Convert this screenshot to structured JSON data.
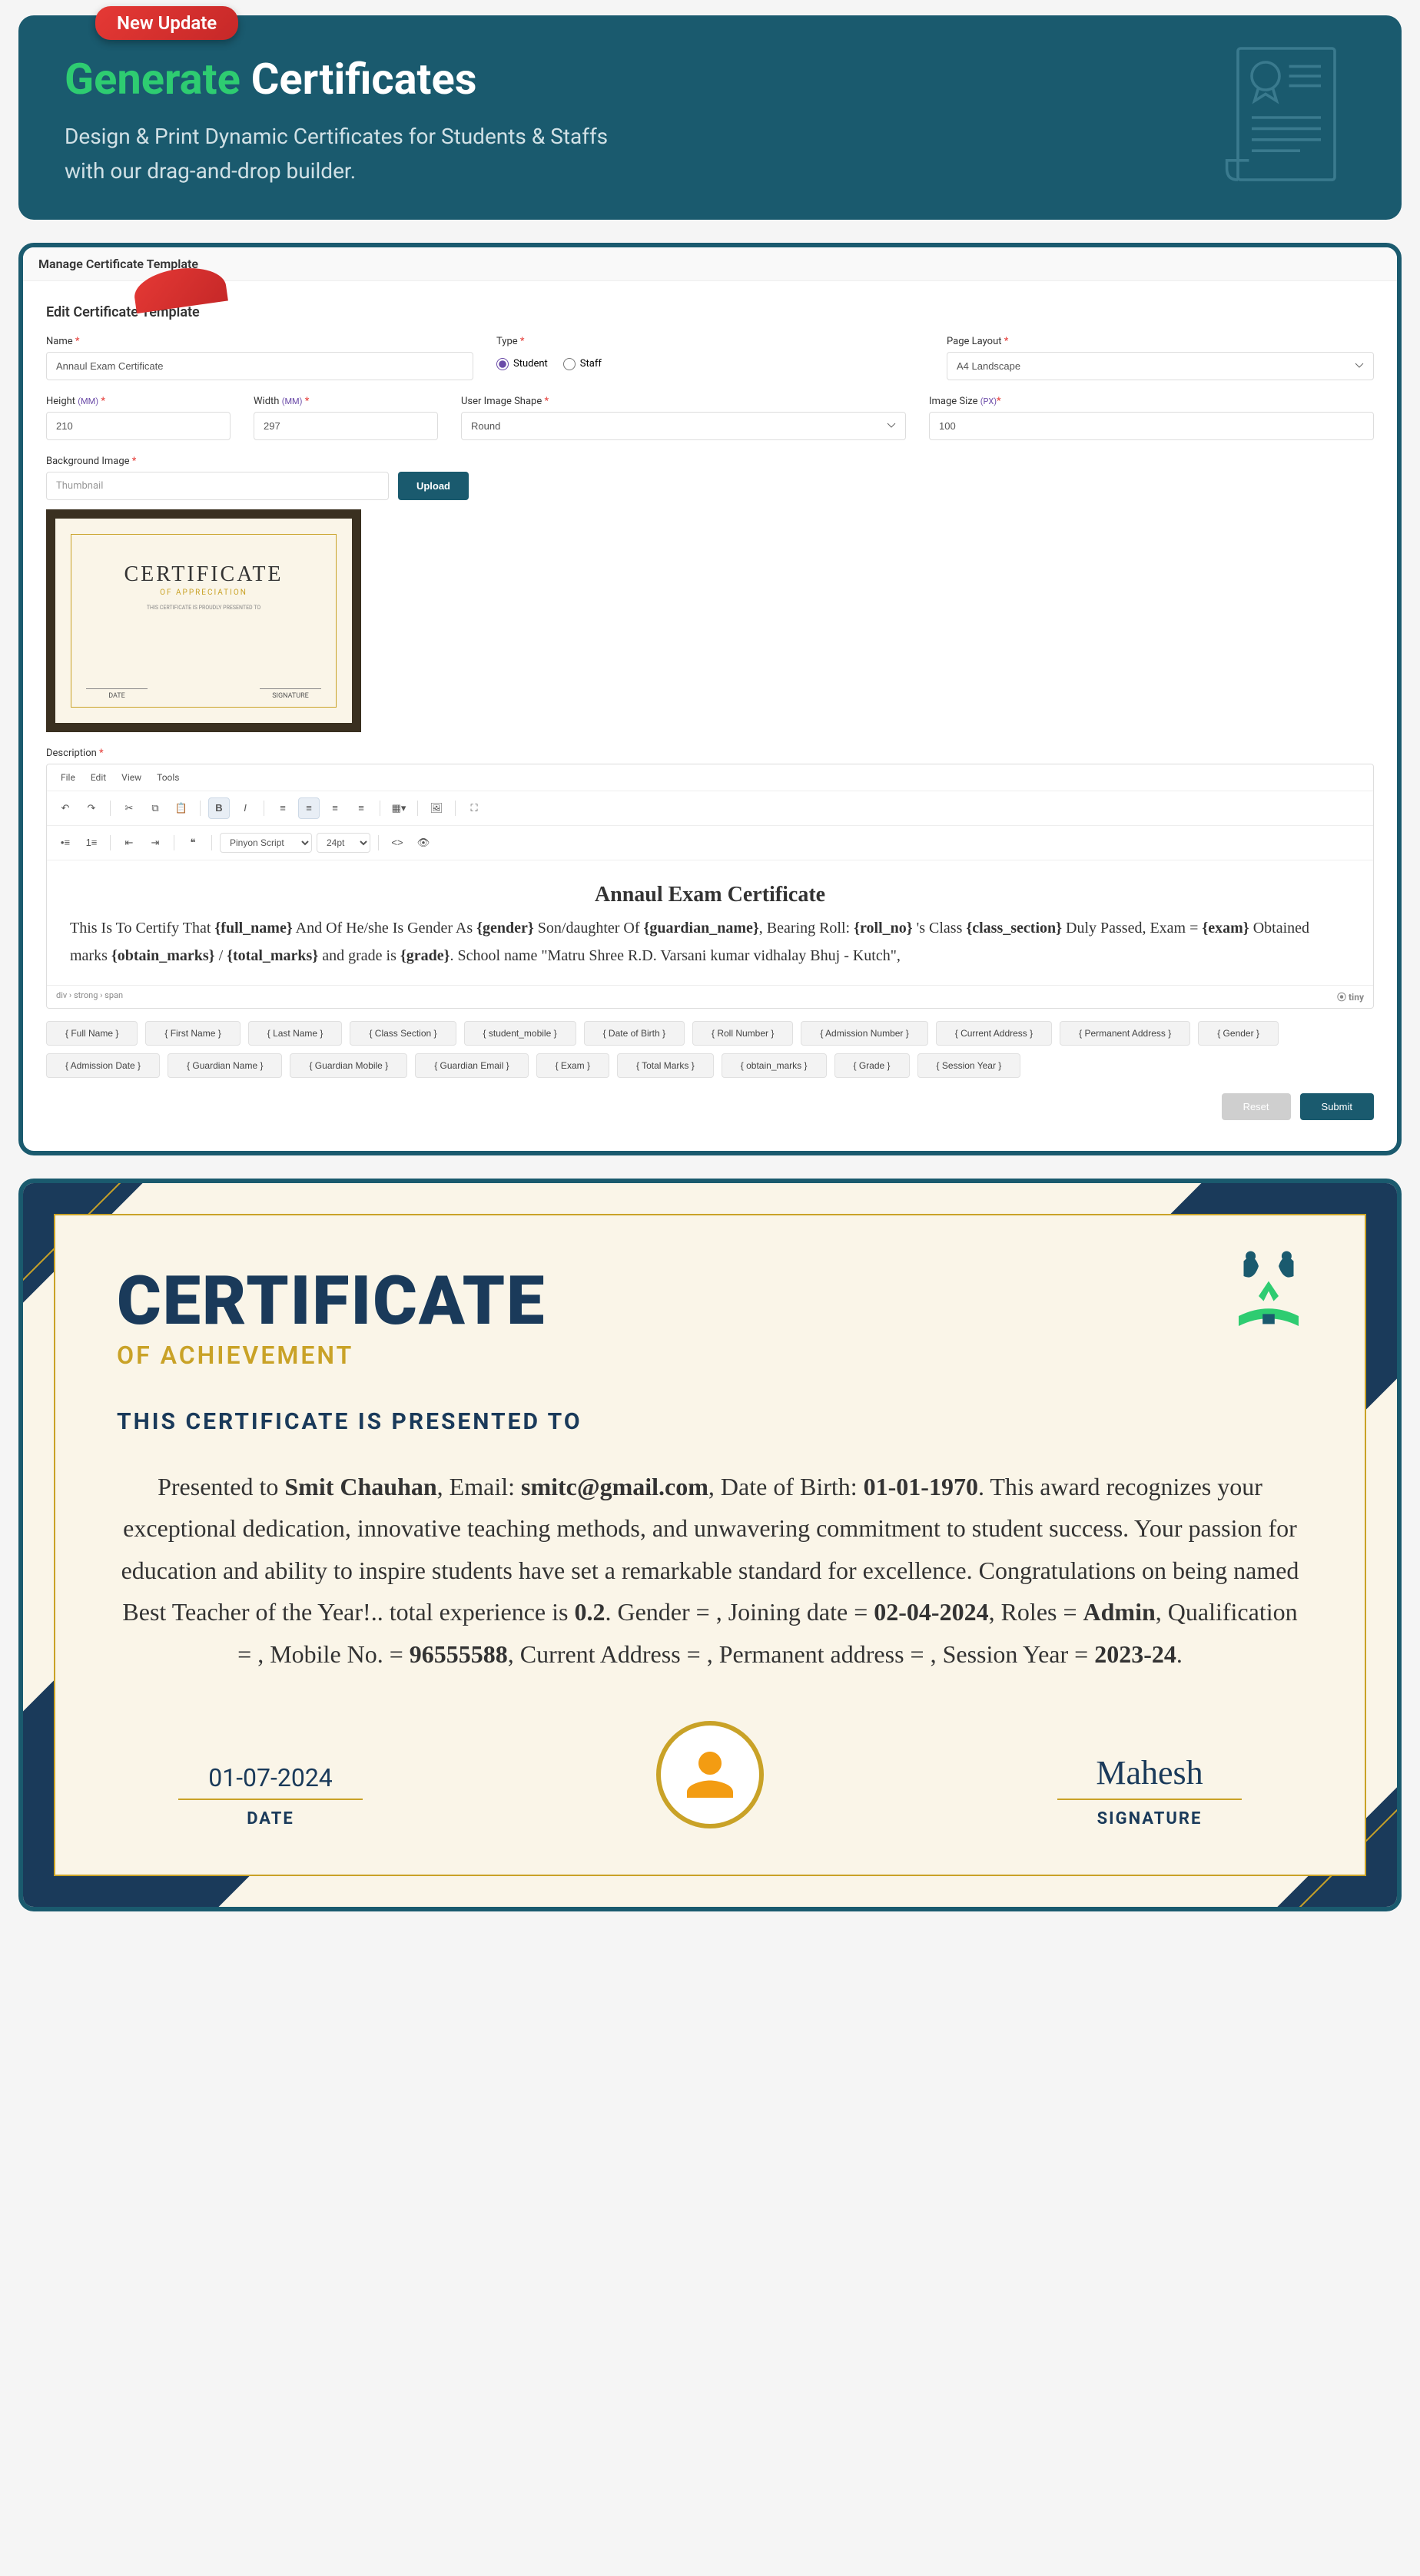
{
  "banner": {
    "badge": "New Update",
    "title_green": "Generate",
    "title_rest": "Certificates",
    "line1": "Design & Print Dynamic Certificates for Students & Staffs",
    "line2": "with our drag-and-drop builder."
  },
  "panel": {
    "header": "Manage Certificate Template",
    "form_title": "Edit Certificate Template",
    "labels": {
      "name": "Name",
      "type": "Type",
      "page_layout": "Page Layout",
      "height": "Height",
      "width": "Width",
      "user_image_shape": "User Image Shape",
      "image_size": "Image Size",
      "background_image": "Background Image",
      "description": "Description",
      "mm_unit": "(MM)",
      "px_unit": "(PX)"
    },
    "values": {
      "name": "Annaul Exam Certificate",
      "page_layout": "A4 Landscape",
      "height": "210",
      "width": "297",
      "shape": "Round",
      "image_size": "100",
      "thumbnail_placeholder": "Thumbnail"
    },
    "type_options": {
      "student": "Student",
      "staff": "Staff"
    },
    "upload_btn": "Upload",
    "thumb": {
      "title": "CERTIFICATE",
      "sub": "OF APPRECIATION",
      "line": "THIS CERTIFICATE IS PROUDLY PRESENTED TO",
      "date": "DATE",
      "sig": "SIGNATURE"
    },
    "editor": {
      "menu": {
        "file": "File",
        "edit": "Edit",
        "view": "View",
        "tools": "Tools"
      },
      "font": "Pinyon Script",
      "size": "24pt",
      "content_title": "Annaul Exam Certificate",
      "content_body": "This Is To Certify That {full_name} And Of He/she Is Gender As {gender} Son/daughter Of {guardian_name}, Bearing Roll: {roll_no} 's Class {class_section} Duly Passed, Exam = {exam} Obtained marks {obtain_marks} / {total_marks} and grade is {grade}. School name \"Matru Shree R.D. Varsani kumar vidhalay Bhuj - Kutch\",",
      "path": "div › strong › span",
      "powered": "tiny"
    },
    "tags": [
      "{ Full Name }",
      "{ First Name }",
      "{ Last Name }",
      "{ Class Section }",
      "{ student_mobile }",
      "{ Date of Birth }",
      "{ Roll Number }",
      "{ Admission Number }",
      "{ Current Address }",
      "{ Permanent Address }",
      "{ Gender }",
      "{ Admission Date }",
      "{ Guardian Name }",
      "{ Guardian Mobile }",
      "{ Guardian Email }",
      "{ Exam }",
      "{ Total Marks }",
      "{ obtain_marks }",
      "{ Grade }",
      "{ Session Year }"
    ],
    "reset": "Reset",
    "submit": "Submit"
  },
  "cert": {
    "h1": "CERTIFICATE",
    "h2": "OF ACHIEVEMENT",
    "h3": "THIS CERTIFICATE IS PRESENTED TO",
    "body": "Presented to Smit Chauhan, Email: smitc@gmail.com, Date of Birth: 01-01-1970. This award recognizes your exceptional dedication, innovative teaching methods, and unwavering commitment to student success. Your passion for education and ability to inspire students have set a remarkable standard for excellence. Congratulations on being named Best Teacher of the Year!.. total experience is 0.2. Gender = , Joining date = 02-04-2024, Roles = Admin, Qualification = , Mobile No. = 96555588, Current Address = , Permanent address = , Session Year = 2023-24.",
    "date": "01-07-2024",
    "date_label": "DATE",
    "sig": "Mahesh",
    "sig_label": "SIGNATURE"
  }
}
